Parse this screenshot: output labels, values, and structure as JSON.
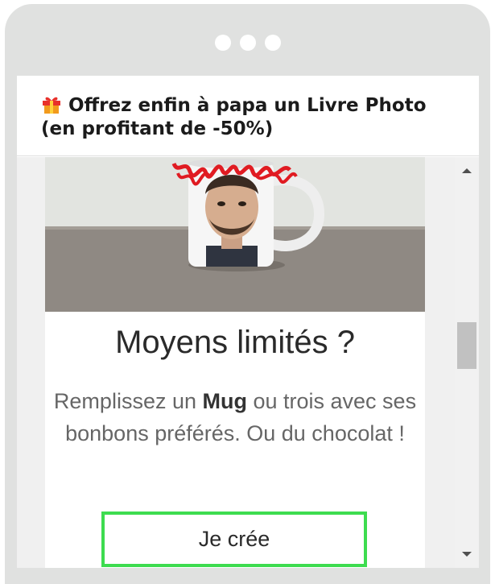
{
  "window": {
    "dots_count": 3
  },
  "email": {
    "subject_icon": "gift-icon",
    "subject_line1": "Offrez enfin à papa un Livre Photo",
    "subject_line2": "(en profitant de -50%)"
  },
  "hero_image": {
    "icon": "mug-photo-illustration"
  },
  "content": {
    "headline": "Moyens limités ?",
    "body_pre": "Remplissez un ",
    "body_bold": "Mug",
    "body_post": " ou trois avec ses bonbons préférés. Ou du chocolat !",
    "cta_label": "Je crée"
  },
  "colors": {
    "frame": "#e0e1e0",
    "cta_border": "#3ddc4f",
    "headline_text": "#2a2a2a",
    "body_text": "#666666"
  }
}
